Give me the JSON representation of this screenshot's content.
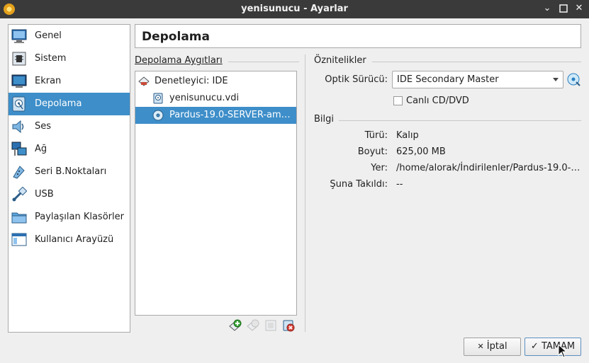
{
  "window": {
    "title": "yenisunucu - Ayarlar"
  },
  "sidebar": {
    "items": [
      {
        "label": "Genel",
        "icon": "monitor-icon"
      },
      {
        "label": "Sistem",
        "icon": "chip-icon"
      },
      {
        "label": "Ekran",
        "icon": "display-icon"
      },
      {
        "label": "Depolama",
        "icon": "storage-icon",
        "active": true
      },
      {
        "label": "Ses",
        "icon": "speaker-icon"
      },
      {
        "label": "Ağ",
        "icon": "network-icon"
      },
      {
        "label": "Seri B.Noktaları",
        "icon": "serial-port-icon"
      },
      {
        "label": "USB",
        "icon": "usb-icon"
      },
      {
        "label": "Paylaşılan Klasörler",
        "icon": "folder-icon"
      },
      {
        "label": "Kullanıcı Arayüzü",
        "icon": "window-icon"
      }
    ]
  },
  "header": {
    "title": "Depolama"
  },
  "storage": {
    "group_title": "Depolama Aygıtları",
    "controller": "Denetleyici: IDE",
    "items": [
      {
        "label": "yenisunucu.vdi",
        "icon": "hard-disk-icon"
      },
      {
        "label": "Pardus-19.0-SERVER-am…",
        "icon": "optical-disc-icon",
        "selected": true
      }
    ]
  },
  "attributes": {
    "group_title": "Öznitelikler",
    "optical_drive_label": "Optik Sürücü:",
    "optical_drive_value": "IDE Secondary Master",
    "live_cd_label": "Canlı CD/DVD",
    "live_cd_checked": false
  },
  "info": {
    "group_title": "Bilgi",
    "type_label": "Türü:",
    "type_value": "Kalıp",
    "size_label": "Boyut:",
    "size_value": "625,00 MB",
    "location_label": "Yer:",
    "location_value": "/home/alorak/İndirilenler/Pardus-19.0-…",
    "attached_label": "Şuna Takıldı:",
    "attached_value": "--"
  },
  "buttons": {
    "cancel": "İptal",
    "ok": "TAMAM"
  },
  "colors": {
    "selection": "#3d8ec9",
    "titlebar": "#3a3a3a"
  }
}
